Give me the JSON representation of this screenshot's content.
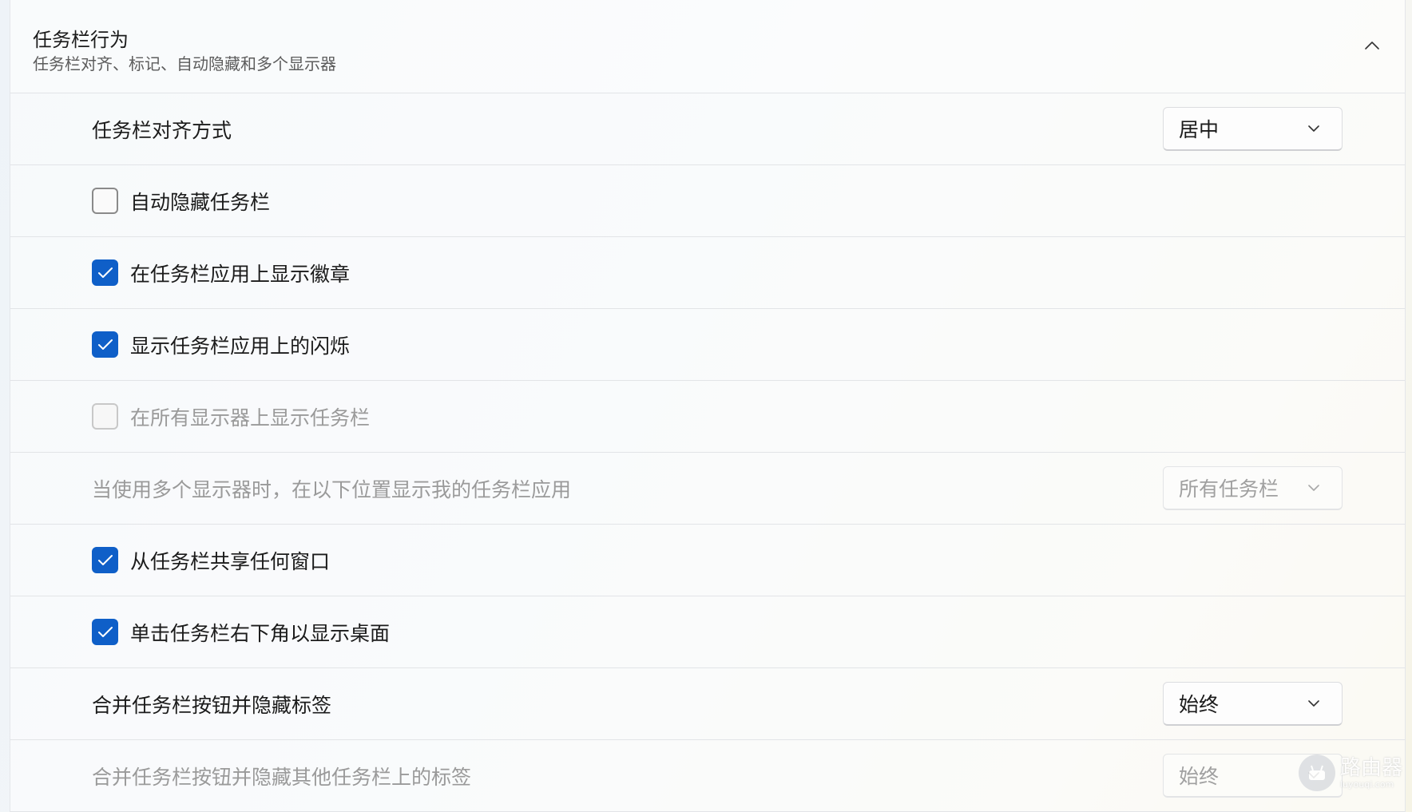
{
  "header": {
    "title": "任务栏行为",
    "subtitle": "任务栏对齐、标记、自动隐藏和多个显示器"
  },
  "rows": [
    {
      "type": "dropdown",
      "label": "任务栏对齐方式",
      "value": "居中",
      "disabled": false
    },
    {
      "type": "checkbox",
      "label": "自动隐藏任务栏",
      "checked": false,
      "disabled": false
    },
    {
      "type": "checkbox",
      "label": "在任务栏应用上显示徽章",
      "checked": true,
      "disabled": false
    },
    {
      "type": "checkbox",
      "label": "显示任务栏应用上的闪烁",
      "checked": true,
      "disabled": false
    },
    {
      "type": "checkbox",
      "label": "在所有显示器上显示任务栏",
      "checked": false,
      "disabled": true
    },
    {
      "type": "dropdown",
      "label": "当使用多个显示器时，在以下位置显示我的任务栏应用",
      "value": "所有任务栏",
      "disabled": true
    },
    {
      "type": "checkbox",
      "label": "从任务栏共享任何窗口",
      "checked": true,
      "disabled": false
    },
    {
      "type": "checkbox",
      "label": "单击任务栏右下角以显示桌面",
      "checked": true,
      "disabled": false
    },
    {
      "type": "dropdown",
      "label": "合并任务栏按钮并隐藏标签",
      "value": "始终",
      "disabled": false
    },
    {
      "type": "dropdown",
      "label": "合并任务栏按钮并隐藏其他任务栏上的标签",
      "value": "始终",
      "disabled": true
    }
  ],
  "icons": {
    "collapse": "chevron-up-icon",
    "dropdown": "chevron-down-icon",
    "check": "checkmark-icon"
  },
  "colors": {
    "accent": "#0f5fc8",
    "disabled_text": "#9a9a9a"
  },
  "watermark": {
    "text": "路由器",
    "subtext": "luyouqi.com"
  }
}
